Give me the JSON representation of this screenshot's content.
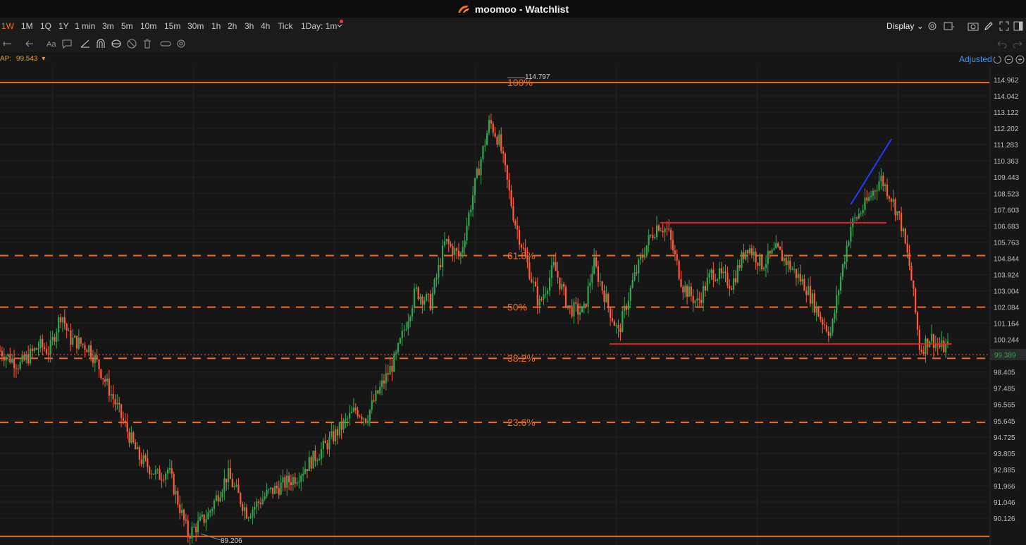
{
  "window": {
    "app": "moomoo",
    "title": "moomoo - Watchlist"
  },
  "timeframes": [
    {
      "label": "1W",
      "active": true
    },
    {
      "label": "1M"
    },
    {
      "label": "1Q"
    },
    {
      "label": "1Y"
    },
    {
      "label": "1 min"
    },
    {
      "label": "3m"
    },
    {
      "label": "5m"
    },
    {
      "label": "10m"
    },
    {
      "label": "15m"
    },
    {
      "label": "30m"
    },
    {
      "label": "1h"
    },
    {
      "label": "2h"
    },
    {
      "label": "3h"
    },
    {
      "label": "4h"
    },
    {
      "label": "Tick"
    },
    {
      "label": "1Day: 1m"
    }
  ],
  "display_label": "Display",
  "vwap": {
    "label": "AP:",
    "value": "99.543"
  },
  "adjusted_label": "Adjusted",
  "colors": {
    "accent": "#ff6a1a",
    "fib": "#f26a1c",
    "candle_up": "#2fa84f",
    "candle_down": "#ff5a3a",
    "line_red": "#e02222",
    "line_blue": "#1f3cff"
  },
  "chart_data": {
    "type": "line",
    "price_axis_ticks": [
      "114.962",
      "114.042",
      "113.122",
      "112.202",
      "111.283",
      "110.363",
      "109.443",
      "108.523",
      "107.603",
      "106.683",
      "105.763",
      "104.844",
      "103.924",
      "103.004",
      "102.084",
      "101.164",
      "100.244",
      "98.405",
      "97.485",
      "96.565",
      "95.645",
      "94.725",
      "93.805",
      "92.885",
      "91.966",
      "91.046",
      "90.126"
    ],
    "current_price": "99.389",
    "high_label": "114.797",
    "low_label": "89.206",
    "fibonacci": [
      {
        "label": "100%",
        "price": 114.797
      },
      {
        "label": "61.8%",
        "price": 105.0
      },
      {
        "label": "50%",
        "price": 102.08
      },
      {
        "label": "38.2%",
        "price": 99.18
      },
      {
        "label": "23.6%",
        "price": 95.55
      }
    ],
    "fib_base_price": 89.1,
    "horizontal_lines": [
      {
        "price": 106.86,
        "from": 0.667,
        "to": 0.896
      },
      {
        "price": 100.0,
        "from": 0.616,
        "to": 0.962
      }
    ],
    "trend_line": {
      "from": [
        0.86,
        107.9
      ],
      "to": [
        0.901,
        111.6
      ]
    },
    "price_path": [
      [
        0,
        99.6
      ],
      [
        0.02,
        98.8
      ],
      [
        0.04,
        99.9
      ],
      [
        0.05,
        99.6
      ],
      [
        0.062,
        101.8
      ],
      [
        0.07,
        100.3
      ],
      [
        0.09,
        99.8
      ],
      [
        0.1,
        98.7
      ],
      [
        0.12,
        96.2
      ],
      [
        0.14,
        93.6
      ],
      [
        0.16,
        92.5
      ],
      [
        0.17,
        92.9
      ],
      [
        0.19,
        89.2
      ],
      [
        0.21,
        90.3
      ],
      [
        0.23,
        92.6
      ],
      [
        0.25,
        90.4
      ],
      [
        0.27,
        91.5
      ],
      [
        0.3,
        92.5
      ],
      [
        0.33,
        94.3
      ],
      [
        0.36,
        96.3
      ],
      [
        0.37,
        95.8
      ],
      [
        0.38,
        97.0
      ],
      [
        0.4,
        99.2
      ],
      [
        0.42,
        103.0
      ],
      [
        0.435,
        102.3
      ],
      [
        0.45,
        105.8
      ],
      [
        0.465,
        104.9
      ],
      [
        0.48,
        109.0
      ],
      [
        0.495,
        112.6
      ],
      [
        0.505,
        111.4
      ],
      [
        0.52,
        107.0
      ],
      [
        0.53,
        105.1
      ],
      [
        0.545,
        102.2
      ],
      [
        0.56,
        104.4
      ],
      [
        0.575,
        102.0
      ],
      [
        0.59,
        101.8
      ],
      [
        0.6,
        104.6
      ],
      [
        0.615,
        102.1
      ],
      [
        0.625,
        100.6
      ],
      [
        0.64,
        103.6
      ],
      [
        0.655,
        105.8
      ],
      [
        0.665,
        106.8
      ],
      [
        0.675,
        106.4
      ],
      [
        0.69,
        103.3
      ],
      [
        0.705,
        102.3
      ],
      [
        0.72,
        104.1
      ],
      [
        0.74,
        103.4
      ],
      [
        0.755,
        105.6
      ],
      [
        0.77,
        104.5
      ],
      [
        0.785,
        105.3
      ],
      [
        0.8,
        104.3
      ],
      [
        0.815,
        103.2
      ],
      [
        0.83,
        101.4
      ],
      [
        0.84,
        100.6
      ],
      [
        0.85,
        103.9
      ],
      [
        0.86,
        106.7
      ],
      [
        0.875,
        107.9
      ],
      [
        0.89,
        109.4
      ],
      [
        0.9,
        108.4
      ],
      [
        0.91,
        107.0
      ],
      [
        0.92,
        104.2
      ],
      [
        0.93,
        99.6
      ],
      [
        0.94,
        100.4
      ],
      [
        0.95,
        99.8
      ]
    ]
  }
}
